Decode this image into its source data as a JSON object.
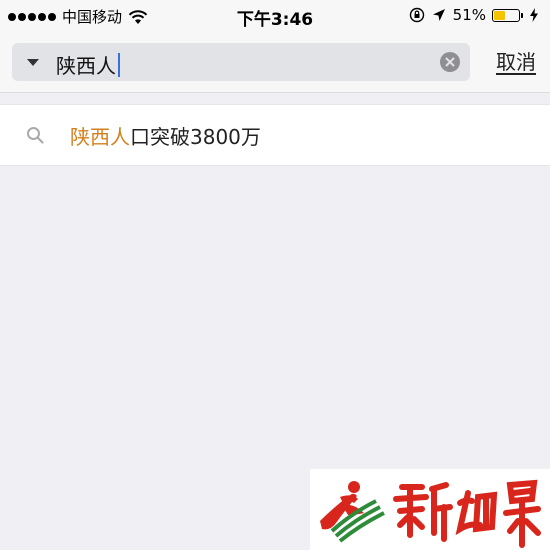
{
  "status_bar": {
    "carrier": "中国移动",
    "time": "下午3:46",
    "battery_percent": "51%",
    "battery_level": 0.51,
    "icons": [
      "signal-dots-icon",
      "wifi-icon",
      "rotation-lock-icon",
      "location-arrow-icon",
      "battery-icon",
      "charging-bolt-icon"
    ]
  },
  "search": {
    "query": "陕西人",
    "cancel_label": "取消"
  },
  "suggestions": [
    {
      "highlight": "陕西人",
      "rest": "口突破3800万"
    }
  ],
  "watermark": {
    "logo_text": "新西部"
  },
  "colors": {
    "background": "#efeff4",
    "highlight": "#d4801e",
    "cursor": "#3a6fe0",
    "battery": "#f5c400",
    "logo_red": "#d8261c",
    "logo_green": "#2e8b3a"
  }
}
